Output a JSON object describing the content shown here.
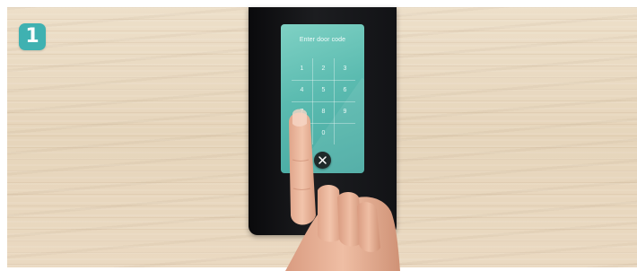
{
  "step": {
    "number": "1",
    "color": "#3fb1b1"
  },
  "screen": {
    "title": "Enter door code",
    "accent": "#5bbbb0"
  },
  "keypad": {
    "keys": [
      "1",
      "2",
      "3",
      "4",
      "5",
      "6",
      "7",
      "8",
      "9",
      "0"
    ]
  },
  "clear_button": {
    "icon": "close-icon"
  }
}
